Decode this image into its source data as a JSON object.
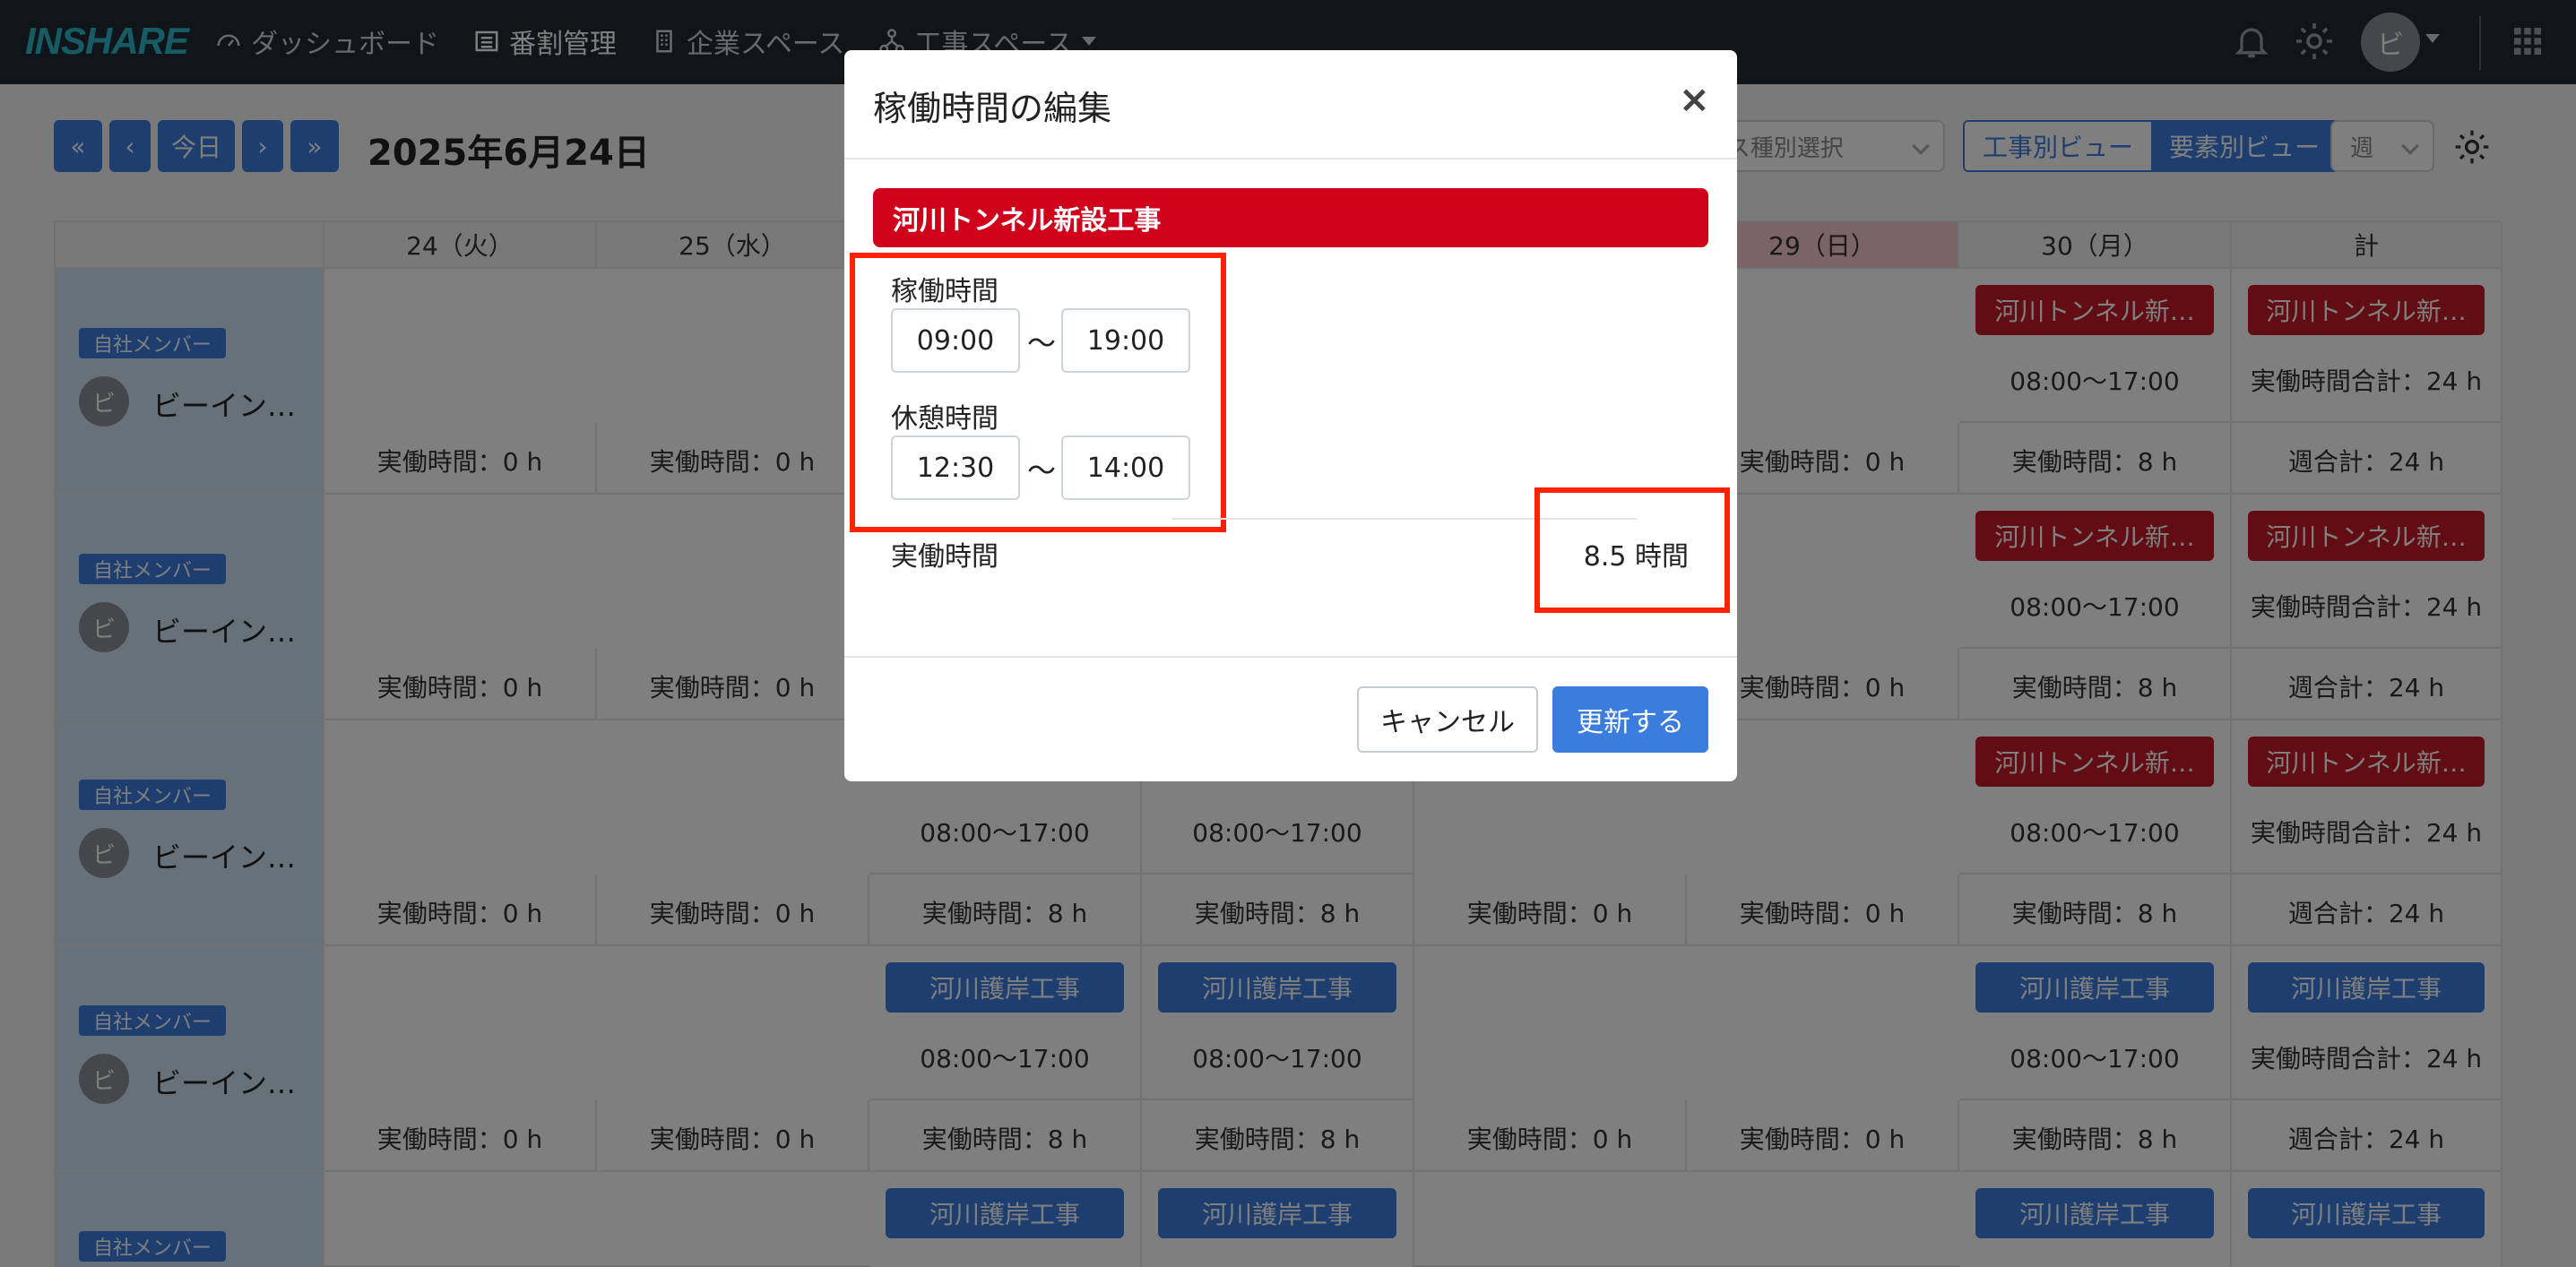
{
  "nav": {
    "logo": "INSHARE",
    "links": [
      "ダッシュボード",
      "番割管理",
      "企業スペース",
      "工事スペース"
    ],
    "avatar": "ビ"
  },
  "toolbar": {
    "first": "«",
    "prev": "‹",
    "today": "今日",
    "next": "›",
    "last": "»",
    "date": "2025年6月24日",
    "space_select": "ース種別選択",
    "view_project": "工事別ビュー",
    "view_element": "要素別ビュー",
    "period": "週"
  },
  "table": {
    "headers": [
      "24（火）",
      "25（水）",
      "",
      "",
      "",
      "29（日）",
      "30（月）",
      "計"
    ],
    "member_badge": "自社メンバー",
    "member_avatar": "ビ",
    "member_name": "ビーイン…",
    "work_zero": "実働時間：0 h",
    "work_eight": "実働時間：8 h",
    "time_range": "08:00〜17:00",
    "total_work": "実働時間合計：24 h",
    "week_total": "週合計：24 h",
    "chip_tunnel": "河川トンネル新…",
    "chip_bank": "河川護岸工事"
  },
  "modal": {
    "title": "稼働時間の編集",
    "close": "×",
    "project": "河川トンネル新設工事",
    "work_label": "稼働時間",
    "work_start": "09:00",
    "work_end": "19:00",
    "break_label": "休憩時間",
    "break_start": "12:30",
    "break_end": "14:00",
    "tilde": "〜",
    "actual_label": "実働時間",
    "actual_value": "8.5 時間",
    "cancel": "キャンセル",
    "update": "更新する"
  },
  "colors": {
    "nav_bg": "#1f2a33",
    "primary": "#3b7ddd",
    "project_red": "#d0011b",
    "highlight": "#ff2200"
  }
}
